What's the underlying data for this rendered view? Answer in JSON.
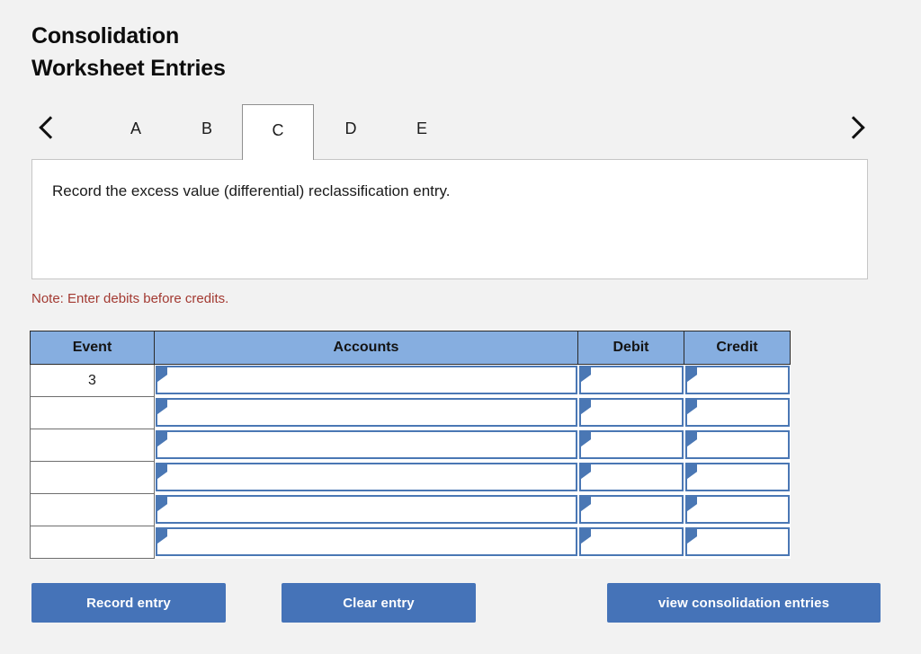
{
  "page": {
    "title": "Consolidation\nWorksheet Entries",
    "background_color": "#f2f2f2"
  },
  "tabs": {
    "prev_icon": "chevron-left-icon",
    "next_icon": "chevron-right-icon",
    "items": [
      {
        "label": "A",
        "active": false
      },
      {
        "label": "B",
        "active": false
      },
      {
        "label": "C",
        "active": true
      },
      {
        "label": "D",
        "active": false
      },
      {
        "label": "E",
        "active": false
      }
    ]
  },
  "description": {
    "text": "Record the excess value (differential) reclassification entry."
  },
  "note": {
    "text": "Note: Enter debits before credits.",
    "color": "#a33a32"
  },
  "journal": {
    "headers": {
      "event": "Event",
      "accounts": "Accounts",
      "debit": "Debit",
      "credit": "Credit"
    },
    "header_color": "#86aee0",
    "input_border_color": "#4a77b4",
    "rows": [
      {
        "event": "3",
        "accounts": "",
        "debit": "",
        "credit": ""
      },
      {
        "event": "",
        "accounts": "",
        "debit": "",
        "credit": ""
      },
      {
        "event": "",
        "accounts": "",
        "debit": "",
        "credit": ""
      },
      {
        "event": "",
        "accounts": "",
        "debit": "",
        "credit": ""
      },
      {
        "event": "",
        "accounts": "",
        "debit": "",
        "credit": ""
      },
      {
        "event": "",
        "accounts": "",
        "debit": "",
        "credit": ""
      }
    ]
  },
  "buttons": {
    "record": "Record entry",
    "clear": "Clear entry",
    "view": "view consolidation entries",
    "color": "#4573b8"
  }
}
